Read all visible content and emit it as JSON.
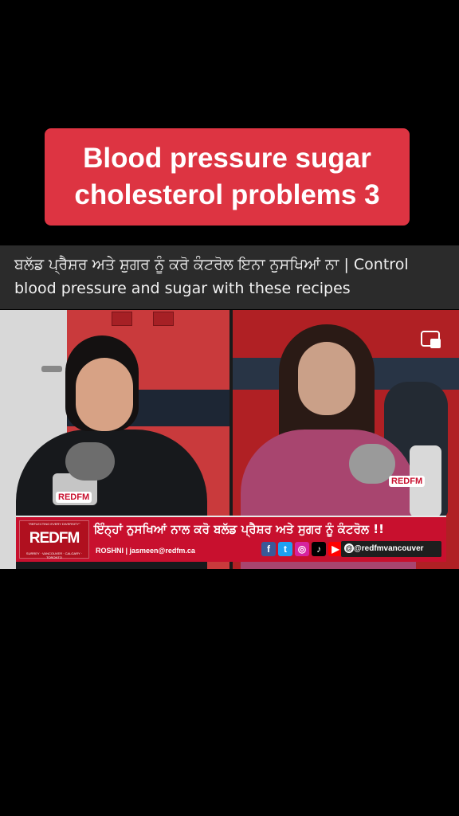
{
  "title_banner": {
    "line1": "Blood pressure sugar",
    "line2": "cholesterol problems 3",
    "color": "#dd3442"
  },
  "caption": {
    "line1": "ਬਲੱਡ ਪ੍ਰੈਸ਼ਰ ਅਤੇ ਸ਼ੁਗਰ ਨੂੰ ਕਰੋ ਕੰਟਰੋਲ ਇਨਾ ਨੁਸਖਿਆਂ ਨਾ | Control",
    "line2": "blood pressure and sugar with these recipes"
  },
  "video": {
    "pip_icon": "picture-in-picture-icon",
    "mic_badge_left": "REDFM",
    "mic_badge_right": "REDFM",
    "lower_third": {
      "logo_tagline": "\"REFLECTING EVERY DIVERSITY\"",
      "logo_text": "REDFM",
      "logo_cities": "SURREY · VANCOUVER · CALGARY · TORONTO",
      "headline": "ਇੰਨ੍ਹਾਂ ਨੁਸਖਿਆਂ ਨਾਲ ਕਰੋ ਬਲੱਡ ਪ੍ਰੈਸ਼ਰ ਅਤੇ ਸੁਗਰ ਨੂੰ ਕੰਟਰੋਲ !!",
      "host_info": "ROSHNI | jasmeen@redfm.ca",
      "social_icons": [
        {
          "icon": "facebook-icon",
          "glyph": "f",
          "color": "#3b5998"
        },
        {
          "icon": "twitter-icon",
          "glyph": "t",
          "color": "#1da1f2"
        },
        {
          "icon": "instagram-icon",
          "glyph": "◎",
          "color": "#d6249f"
        },
        {
          "icon": "tiktok-icon",
          "glyph": "♪",
          "color": "#000000"
        },
        {
          "icon": "youtube-icon",
          "glyph": "▶",
          "color": "#ff0000"
        }
      ],
      "handle": "@redfmvancouver",
      "accent": "#c8102e"
    }
  }
}
